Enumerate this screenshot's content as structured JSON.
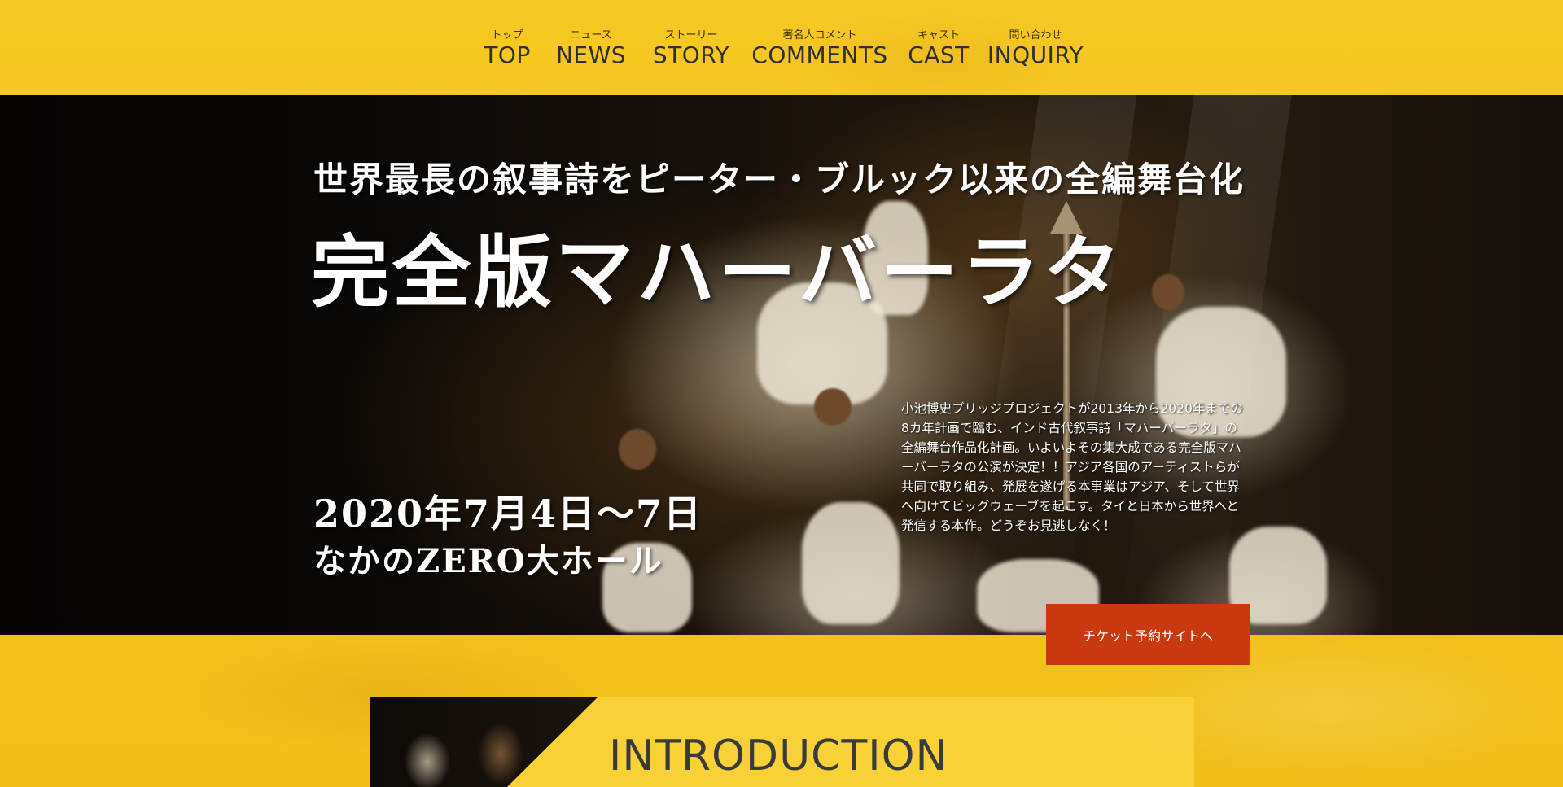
{
  "nav": {
    "items": [
      {
        "sub": "トップ",
        "label": "TOP"
      },
      {
        "sub": "ニュース",
        "label": "NEWS"
      },
      {
        "sub": "ストーリー",
        "label": "STORY"
      },
      {
        "sub": "著名人コメント",
        "label": "COMMENTS"
      },
      {
        "sub": "キャスト",
        "label": "CAST"
      },
      {
        "sub": "問い合わせ",
        "label": "INQUIRY"
      }
    ]
  },
  "hero": {
    "subtitle": "世界最長の叙事詩をピーター・ブルック以来の全編舞台化",
    "title": "完全版マハーバーラタ",
    "date": "2020年7月4日〜7日",
    "venue": "なかのZERO大ホール",
    "description": "小池博史ブリッジプロジェクトが2013年から2020年までの8カ年計画で臨む、インド古代叙事詩「マハーバーラタ」の全編舞台作品化計画。いよいよその集大成である完全版マハーバーラタの公演が決定！！アジア各国のアーティストらが共同で取り組み、発展を遂げる本事業はアジア、そして世界へ向けてビッグウェーブを起こす。タイと日本から世界へと発信する本作。どうぞお見逃しなく！"
  },
  "ticket_button": "チケット予約サイトへ",
  "intro": {
    "heading": "INTRODUCTION"
  },
  "colors": {
    "background_yellow": "#f4c51f",
    "button_red": "#c8390f"
  }
}
